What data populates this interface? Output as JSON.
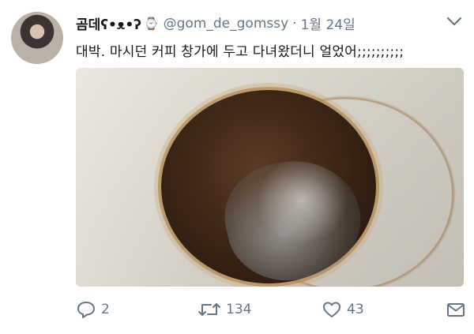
{
  "author": {
    "display_name": "곰데ʕ•ᴥ•ʔ",
    "handle": "@gom_de_gomssy",
    "separator": "·",
    "date": "1월 24일"
  },
  "tweet": {
    "text": "대박. 마시던 커피 창가에 두고 다녀왔더니 얼었어;;;;;;;;;;"
  },
  "actions": {
    "reply_count": "2",
    "retweet_count": "134",
    "like_count": "43"
  },
  "icons": {
    "badge": "watch-icon",
    "menu": "chevron-down-icon",
    "reply": "reply-icon",
    "retweet": "retweet-icon",
    "like": "heart-icon",
    "dm": "envelope-icon"
  },
  "colors": {
    "text": "#14171a",
    "muted": "#657786",
    "background": "#ffffff"
  }
}
